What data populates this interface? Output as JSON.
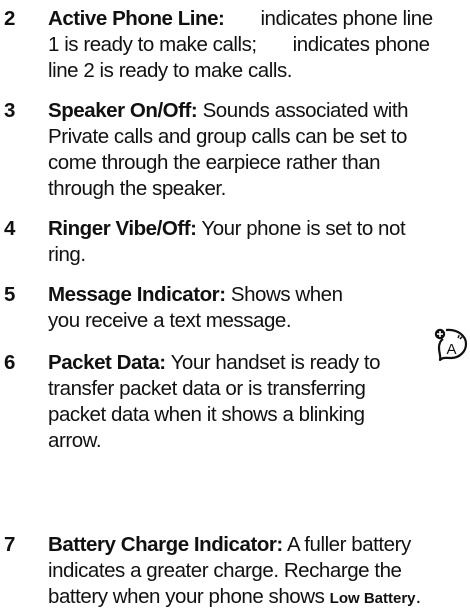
{
  "items": [
    {
      "number": "2",
      "title": "Active Phone Line:",
      "lines": [
        "indicates phone line",
        "1 is ready to make calls;",
        "indicates phone",
        "line 2 is ready to make calls."
      ]
    },
    {
      "number": "3",
      "title": "Speaker On/Off:",
      "lines": [
        "Sounds associated with",
        "Private calls and group calls can be set to",
        "come through the earpiece rather than",
        "through the speaker."
      ]
    },
    {
      "number": "4",
      "title": "Ringer Vibe/Off:",
      "lines": [
        "Your phone is set to not",
        "ring."
      ]
    },
    {
      "number": "5",
      "title": "Message Indicator:",
      "lines": [
        "Shows when",
        "you receive a text message."
      ]
    },
    {
      "number": "6",
      "title": "Packet Data:",
      "lines": [
        "Your handset is ready to",
        "transfer packet data or is transferring",
        "packet data when it shows a blinking",
        "arrow."
      ]
    },
    {
      "number": "7",
      "title": "Battery Charge Indicator:",
      "lines": [
        "A fuller battery",
        "indicates a greater charge. Recharge the",
        "battery when your phone shows",
        "Low Battery",
        "."
      ]
    }
  ],
  "icons": {
    "message_indicator_icon": "text-message-icon"
  }
}
